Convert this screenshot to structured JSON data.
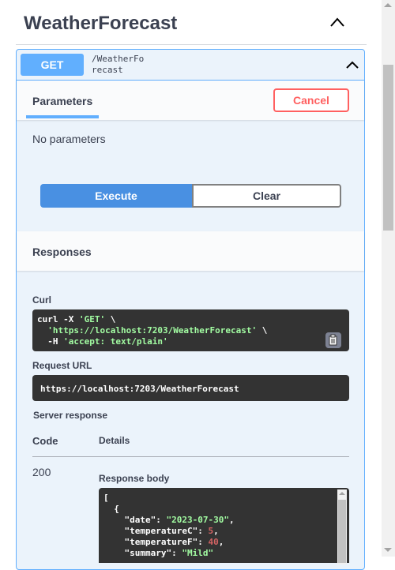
{
  "tag": {
    "title": "WeatherForecast"
  },
  "operation": {
    "method": "GET",
    "path": "/WeatherForecast"
  },
  "parameters": {
    "title": "Parameters",
    "cancel_label": "Cancel",
    "empty_text": "No parameters"
  },
  "actions": {
    "execute_label": "Execute",
    "clear_label": "Clear"
  },
  "responses": {
    "title": "Responses",
    "curl_label": "Curl",
    "curl": {
      "cmd": "curl -X ",
      "method_str": "'GET'",
      "cont1": " \\",
      "url_str": "'https://localhost:7203/WeatherForecast'",
      "cont2": " \\",
      "header_flag": "  -H ",
      "header_str": "'accept: text/plain'"
    },
    "request_url_label": "Request URL",
    "request_url": "https://localhost:7203/WeatherForecast",
    "server_response_label": "Server response",
    "code_header": "Code",
    "details_header": "Details",
    "code": "200",
    "response_body_label": "Response body",
    "body": {
      "open_bracket": "[",
      "open_brace": "  {",
      "date_key": "    \"date\": ",
      "date_val": "\"2023-07-30\"",
      "tempc_key": "    \"temperatureC\": ",
      "tempc_val": "5",
      "tempf_key": "    \"temperatureF\": ",
      "tempf_val": "40",
      "summary_key": "    \"summary\": ",
      "summary_val": "\"Mild\""
    }
  },
  "colors": {
    "get_accent": "#61affe",
    "cancel_red": "#ff6060",
    "execute_blue": "#4990e2",
    "code_bg": "#333333"
  }
}
